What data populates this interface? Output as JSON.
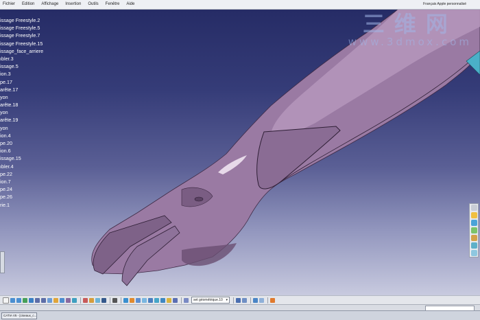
{
  "menubar": {
    "items": [
      "Fichier",
      "Edition",
      "Affichage",
      "Insertion",
      "Outils",
      "Fenêtre",
      "Aide"
    ],
    "right_text": "Français Apple personnalisé"
  },
  "tree": {
    "items": [
      "issage Freestyle.2",
      "issage Freestyle.5",
      "issage Freestyle.7",
      "issage Freestyle.15",
      "issage_face_arriere",
      "ıbler.3",
      "issage.5",
      "ion.3",
      "pe.17",
      "arête.17",
      "yon",
      "arête.18",
      "yon",
      "arête.19",
      "yon",
      "ion.4",
      "pe.20",
      "ion.6",
      "issage.15",
      "ıbler.4",
      "pe.22",
      "ion.7",
      "pe.24",
      "pe.26",
      "rie.1"
    ]
  },
  "watermark": {
    "cn": "三维网",
    "url": "www.3dmox.com"
  },
  "toolbar": {
    "select_value": "set géométrique.10"
  },
  "taskbar": {
    "task_label": "CATIA V5 - [ciseaux_c..."
  },
  "colors": {
    "model_fill": "#9a7aa3",
    "model_highlight": "#c7aecd",
    "model_shadow": "#6a4f72",
    "viewport_top": "#262c66",
    "viewport_bottom": "#c8cadf"
  }
}
